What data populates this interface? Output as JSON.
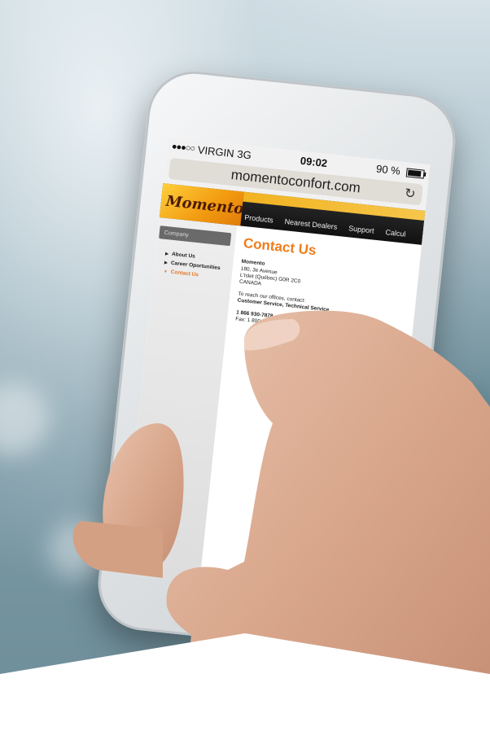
{
  "statusbar": {
    "carrier": "VIRGIN",
    "network": "3G",
    "time": "09:02",
    "battery": "90 %",
    "battery_level": 0.9
  },
  "browser": {
    "url": "momentoconfort.com"
  },
  "site": {
    "logo": "Momento",
    "nav": [
      "Products",
      "Nearest Dealers",
      "Support",
      "Calcul"
    ],
    "sidebar": {
      "section": "Company",
      "items": [
        {
          "label": "About Us",
          "active": false
        },
        {
          "label": "Career Oportunities",
          "active": false
        },
        {
          "label": "Contact Us",
          "active": true
        }
      ]
    },
    "contact": {
      "title": "Contact Us",
      "company": "Momento",
      "address1": "180, 3e Avenue",
      "address2": "L'Islet (Québec) G0R 2C0",
      "country": "CANADA",
      "reach": "To reach our offices, contact:",
      "service": "Customer Service, Technical Service",
      "phone": "1 866 930-7878",
      "fax": "Fax: 1 800 662-7801, 418 247-7801"
    }
  },
  "colors": {
    "accent": "#ef7c1b",
    "logo_gold": "#f29a10"
  }
}
